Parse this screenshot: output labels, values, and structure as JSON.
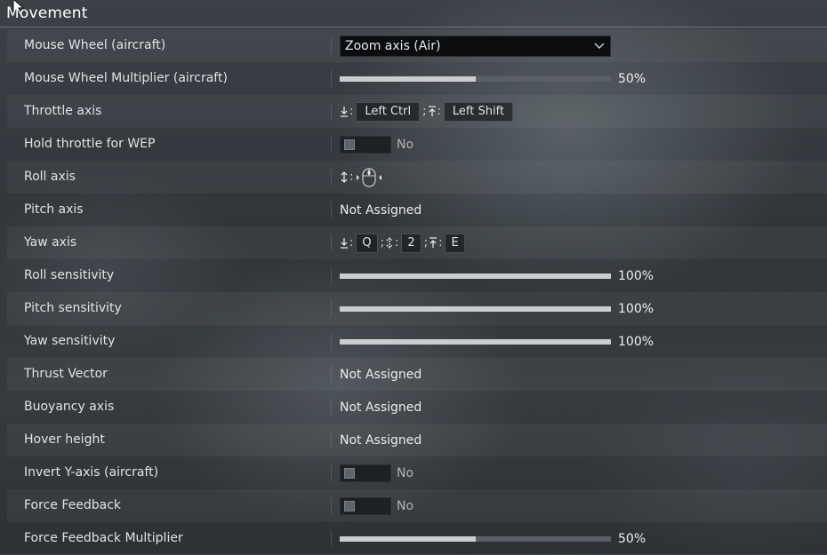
{
  "section": {
    "title": "Movement"
  },
  "rows": [
    {
      "label": "Mouse Wheel (aircraft)",
      "type": "dropdown",
      "value": "Zoom axis (Air)"
    },
    {
      "label": "Mouse Wheel Multiplier (aircraft)",
      "type": "slider",
      "value": 0.5,
      "value_text": "50%"
    },
    {
      "label": "Throttle axis",
      "type": "keys",
      "decrease_key": "Left Ctrl",
      "increase_key": "Left Shift"
    },
    {
      "label": "Hold throttle for WEP",
      "type": "toggle",
      "value": "No"
    },
    {
      "label": "Roll axis",
      "type": "mouse-axis"
    },
    {
      "label": "Pitch axis",
      "type": "text",
      "value": "Not Assigned"
    },
    {
      "label": "Yaw axis",
      "type": "keys3",
      "decrease_key": "Q",
      "center_key": "2",
      "increase_key": "E"
    },
    {
      "label": "Roll sensitivity",
      "type": "slider",
      "value": 1.0,
      "value_text": "100%"
    },
    {
      "label": "Pitch sensitivity",
      "type": "slider",
      "value": 1.0,
      "value_text": "100%"
    },
    {
      "label": "Yaw sensitivity",
      "type": "slider",
      "value": 1.0,
      "value_text": "100%"
    },
    {
      "label": "Thrust Vector",
      "type": "text",
      "value": "Not Assigned"
    },
    {
      "label": "Buoyancy axis",
      "type": "text",
      "value": "Not Assigned"
    },
    {
      "label": "Hover height",
      "type": "text",
      "value": "Not Assigned"
    },
    {
      "label": "Invert Y-axis (aircraft)",
      "type": "toggle",
      "value": "No"
    },
    {
      "label": "Force Feedback",
      "type": "toggle",
      "value": "No"
    },
    {
      "label": "Force Feedback Multiplier",
      "type": "slider",
      "value": 0.5,
      "value_text": "50%"
    }
  ],
  "icons": {
    "decrease": "arrow-down-bar-icon",
    "increase": "arrow-up-bar-icon",
    "center": "arrow-updown-icon",
    "axis": "arrow-updown-icon",
    "mouse": "mouse-horizontal-icon",
    "dropdown": "chevron-down-icon"
  },
  "colors": {
    "slider_fill": "#c9cdd0",
    "slider_track": "#5a6065",
    "dropdown_bg": "#0b0d0f"
  }
}
